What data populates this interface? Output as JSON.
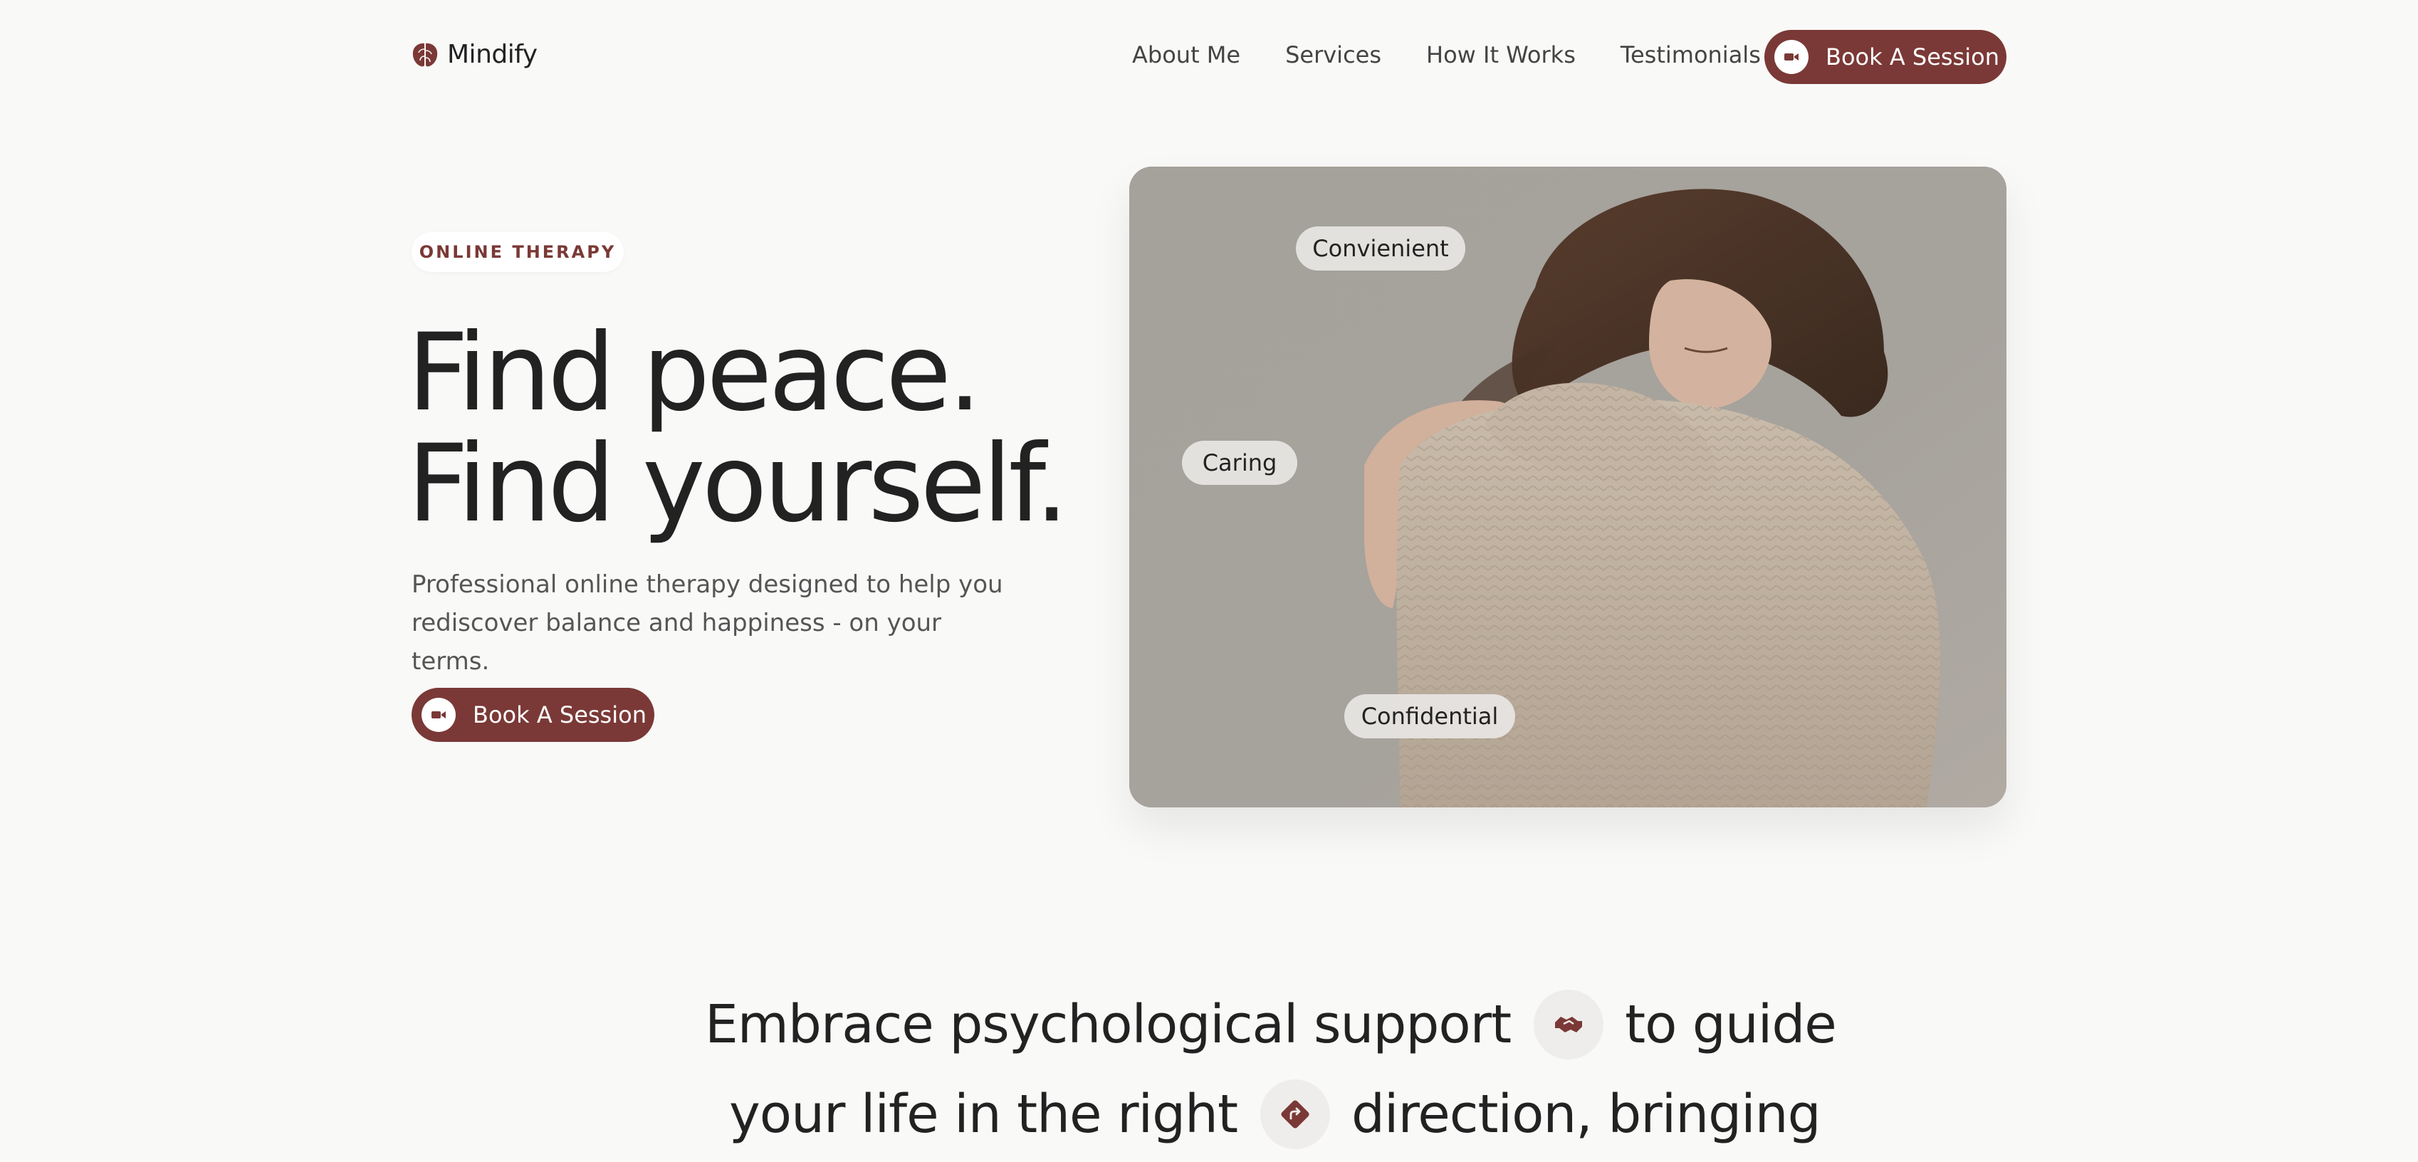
{
  "header": {
    "logo_text": "Mindify",
    "logo_icon": "brain-icon",
    "nav": [
      {
        "label": "About Me"
      },
      {
        "label": "Services"
      },
      {
        "label": "How It Works"
      },
      {
        "label": "Testimonials"
      }
    ],
    "cta_label": "Book A Session",
    "cta_icon": "video-camera-icon"
  },
  "hero": {
    "badge": "ONLINE THERAPY",
    "title_line1": "Find peace.",
    "title_line2": "Find yourself.",
    "subtitle": "Professional online therapy designed to help you rediscover balance and happiness - on your terms.",
    "cta_label": "Book A Session",
    "cta_icon": "video-camera-icon"
  },
  "photo": {
    "tags": [
      "Convienient",
      "Caring",
      "Confidential"
    ]
  },
  "statement": {
    "part1": "Embrace psychological support",
    "icon1": "handshake-icon",
    "part2": "to guide",
    "part3": "your life in the right",
    "icon2": "direction-sign-icon",
    "part4": "direction, bringing"
  },
  "colors": {
    "accent": "#7a3936",
    "background": "#f9f9f8",
    "text": "#222222"
  }
}
